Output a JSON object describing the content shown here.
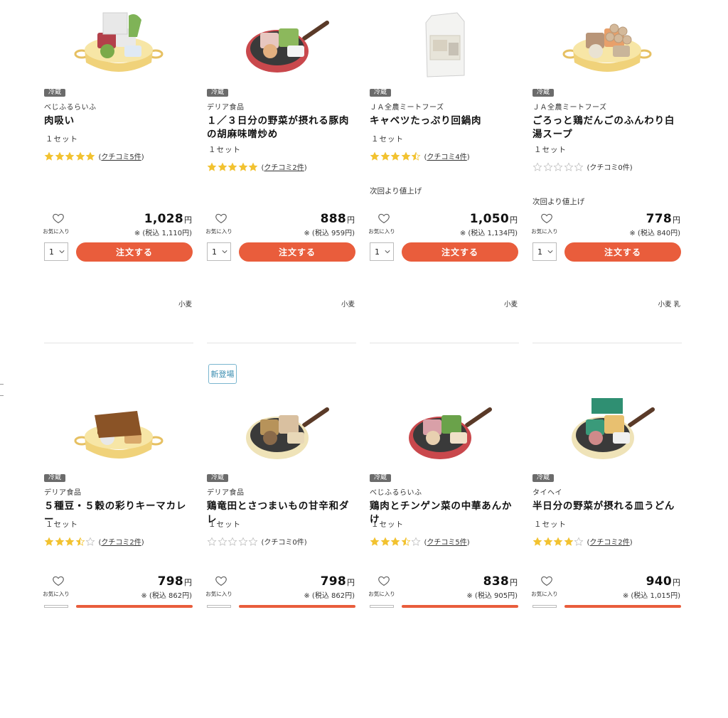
{
  "labels": {
    "favorite": "お気に入り",
    "order_button": "注文する",
    "yen": "円",
    "tax_prefix": "※ (税込 ",
    "tax_suffix": "円)",
    "review_prefix": "(",
    "review_suffix": ")",
    "unit": "１セット",
    "qty_default": "1",
    "next_notice": "次回より値上げ",
    "new_badge": "新登場"
  },
  "colors": {
    "accent": "#e95d3c",
    "star": "#f2c230",
    "star_empty": "#bdbdbd",
    "tag_bg": "#6b6b6b",
    "new_badge": "#3a8db0"
  },
  "products": [
    {
      "storage": "冷蔵",
      "maker": "べじふるらいふ",
      "name": "肉吸い",
      "rating": 5,
      "reviews": "クチコミ5件",
      "reviews_link": true,
      "notice": "",
      "price": "1,028",
      "tax_price": "1,110",
      "allergens": "小麦",
      "is_new": false,
      "image": "pot-with-meat-and-vegetables"
    },
    {
      "storage": "冷蔵",
      "maker": "デリア食品",
      "name": "１／３日分の野菜が摂れる豚肉の胡麻味噌炒め",
      "rating": 5,
      "reviews": "クチコミ2件",
      "reviews_link": true,
      "notice": "",
      "price": "888",
      "tax_price": "959",
      "allergens": "小麦",
      "is_new": false,
      "image": "frying-pan-with-pork-and-vegetables"
    },
    {
      "storage": "冷蔵",
      "maker": "ＪＡ全農ミートフーズ",
      "name": "キャベツたっぷり回鍋肉",
      "rating": 4.5,
      "reviews": "クチコミ4件",
      "reviews_link": true,
      "notice": "次回より値上げ",
      "price": "1,050",
      "tax_price": "1,134",
      "allergens": "小麦",
      "is_new": false,
      "image": "packaged-meal-kit-bag"
    },
    {
      "storage": "冷蔵",
      "maker": "ＪＡ全農ミートフーズ",
      "name": "ごろっと鶏だんごのふんわり白湯スープ",
      "rating": 0,
      "reviews": "クチコミ0件",
      "reviews_link": false,
      "notice": "次回より値上げ",
      "price": "778",
      "tax_price": "840",
      "allergens": "小麦 乳",
      "is_new": false,
      "image": "pot-with-chicken-meatballs"
    },
    {
      "storage": "冷蔵",
      "maker": "デリア食品",
      "name": "５種豆・５穀の彩りキーマカレー",
      "rating": 3.5,
      "reviews": "クチコミ2件",
      "reviews_link": true,
      "notice": "",
      "price": "798",
      "tax_price": "862",
      "allergens": "",
      "is_new": false,
      "image": "pot-with-curry-kit"
    },
    {
      "storage": "冷蔵",
      "maker": "デリア食品",
      "name": "鶏竜田とさつまいもの甘辛和ダレ",
      "rating": 0,
      "reviews": "クチコミ0件",
      "reviews_link": false,
      "notice": "",
      "price": "798",
      "tax_price": "862",
      "allergens": "",
      "is_new": true,
      "image": "frying-pan-with-fried-chicken"
    },
    {
      "storage": "冷蔵",
      "maker": "べじふるらいふ",
      "name": "鶏肉とチンゲン菜の中華あんかけ",
      "rating": 3.5,
      "reviews": "クチコミ5件",
      "reviews_link": true,
      "notice": "",
      "price": "838",
      "tax_price": "905",
      "allergens": "",
      "is_new": false,
      "image": "frying-pan-with-chicken-and-greens"
    },
    {
      "storage": "冷蔵",
      "maker": "タイヘイ",
      "name": "半日分の野菜が摂れる皿うどん",
      "rating": 4,
      "reviews": "クチコミ2件",
      "reviews_link": true,
      "notice": "",
      "price": "940",
      "tax_price": "1,015",
      "allergens": "",
      "is_new": false,
      "image": "frying-pan-with-noodle-kit"
    }
  ]
}
